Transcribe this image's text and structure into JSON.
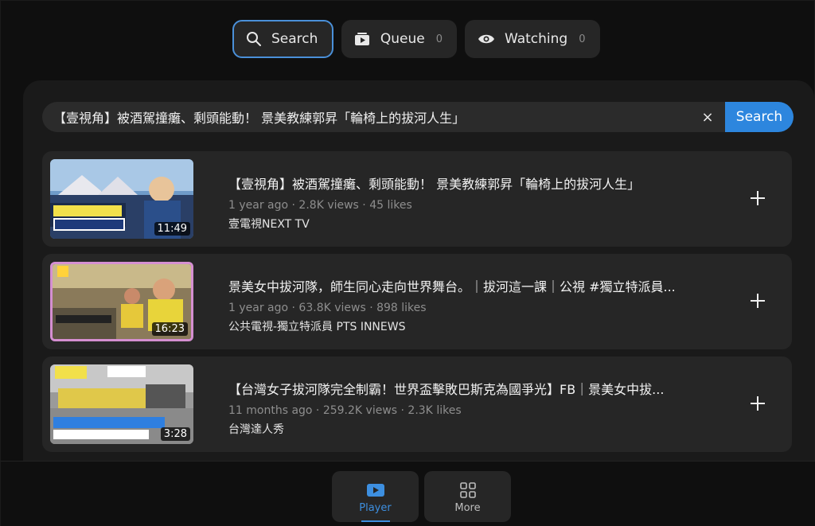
{
  "tabs": [
    {
      "label": "Search",
      "icon": "search-icon",
      "count": ""
    },
    {
      "label": "Queue",
      "icon": "queue-icon",
      "count": "0"
    },
    {
      "label": "Watching",
      "icon": "eye-icon",
      "count": "0"
    }
  ],
  "search": {
    "value": "【壹視角】被酒駕撞癱、剩頭能動！ 景美教練郭昇「輪椅上的拔河人生」",
    "clear_label": "×",
    "button_label": "Search"
  },
  "results": [
    {
      "title": "【壹視角】被酒駕撞癱、剩頭能動！ 景美教練郭昇「輪椅上的拔河人生」",
      "meta": "1 year ago · 2.8K views · 45 likes",
      "channel": "壹電視NEXT TV",
      "duration": "11:49"
    },
    {
      "title": "景美女中拔河隊，師生同心走向世界舞台。｜拔河這一課｜公視 #獨立特派員...",
      "meta": "1 year ago · 63.8K views · 898 likes",
      "channel": "公共電視-獨立特派員 PTS INNEWS",
      "duration": "16:23"
    },
    {
      "title": "【台灣女子拔河隊完全制霸！世界盃擊敗巴斯克為國爭光】FB｜景美女中拔...",
      "meta": "11 months ago · 259.2K views · 2.3K likes",
      "channel": "台灣達人秀",
      "duration": "3:28"
    }
  ],
  "bottom_nav": [
    {
      "label": "Player",
      "icon": "play-icon"
    },
    {
      "label": "More",
      "icon": "grid-icon"
    }
  ],
  "colors": {
    "accent": "#2d86de",
    "background": "#0f0f0f",
    "panel": "#1a1a1a",
    "card": "#262626"
  }
}
